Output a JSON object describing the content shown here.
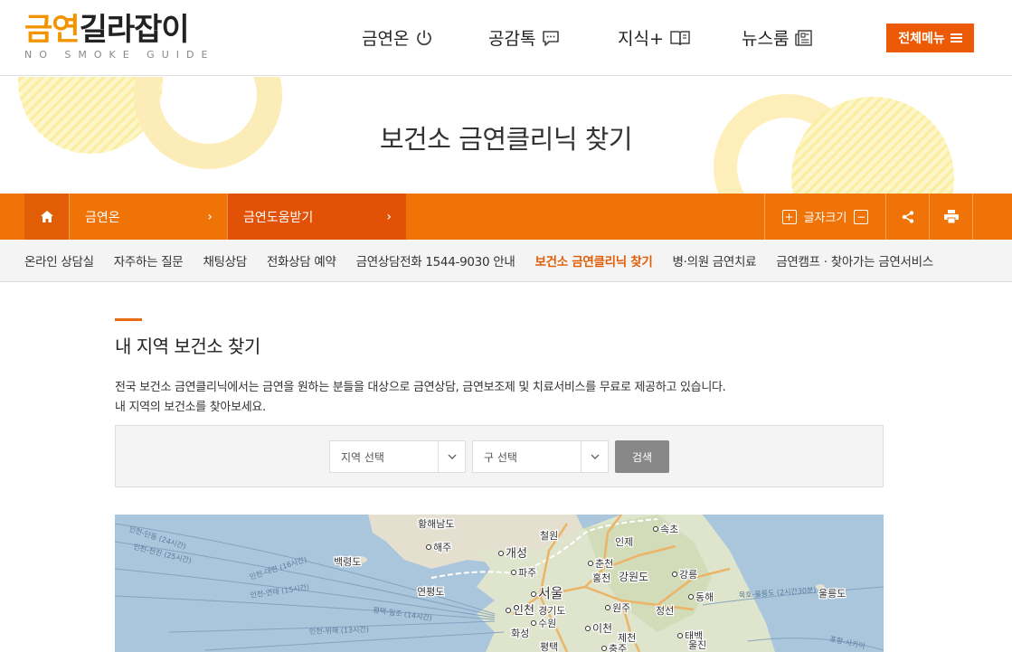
{
  "header": {
    "logo": {
      "orange": "금연",
      "dark": "길라잡이",
      "sub": "NO SMOKE GUIDE"
    },
    "nav": [
      {
        "label": "금연온",
        "icon": "power-icon"
      },
      {
        "label": "공감톡",
        "icon": "chat-bubble-icon"
      },
      {
        "label": "지식+",
        "icon": "book-icon"
      },
      {
        "label": "뉴스룸",
        "icon": "newspaper-icon"
      }
    ],
    "all_menu_label": "전체메뉴"
  },
  "banner": {
    "title": "보건소 금연클리닉 찾기"
  },
  "location": {
    "items": [
      "금연온",
      "금연도움받기"
    ],
    "font_size_label": "글자크기"
  },
  "subtabs": [
    "온라인 상담실",
    "자주하는 질문",
    "채팅상담",
    "전화상담 예약",
    "금연상담전화 1544-9030 안내",
    "보건소 금연클리닉 찾기",
    "병·의원 금연치료",
    "금연캠프 · 찾아가는 금연서비스"
  ],
  "active_subtab": 5,
  "content": {
    "heading": "내 지역 보건소 찾기",
    "desc_line1": "전국 보건소 금연클리닉에서는 금연을 원하는 분들을 대상으로 금연상담, 금연보조제 및 치료서비스를 무료로 제공하고 있습니다.",
    "desc_line2": "내 지역의 보건소를 찾아보세요."
  },
  "search": {
    "region_select": "지역 선택",
    "district_select": "구 선택",
    "button": "검색"
  },
  "map": {
    "labels": [
      "황해남도",
      "해주",
      "개성",
      "철원",
      "인제",
      "속초",
      "백령도",
      "파주",
      "춘천",
      "강원도",
      "강릉",
      "연평도",
      "서울",
      "홍천",
      "동해",
      "울릉도",
      "인천",
      "경기도",
      "원주",
      "정선",
      "수원",
      "이천",
      "화성",
      "제천",
      "태백",
      "평택",
      "충주",
      "울진"
    ],
    "routes": [
      "인천-대련 (16시간)",
      "인천-연태 (15시간)",
      "인천-위해 (13시간)",
      "인천-단동 (24시간)",
      "인천-천진 (25시간)",
      "평택-일조 (14시간)",
      "목호-울릉도 (2시간30분)",
      "포항-사카이"
    ]
  },
  "colors": {
    "brand": "#f07308",
    "brand_dark": "#e25206",
    "active_tab": "#e25e06"
  }
}
